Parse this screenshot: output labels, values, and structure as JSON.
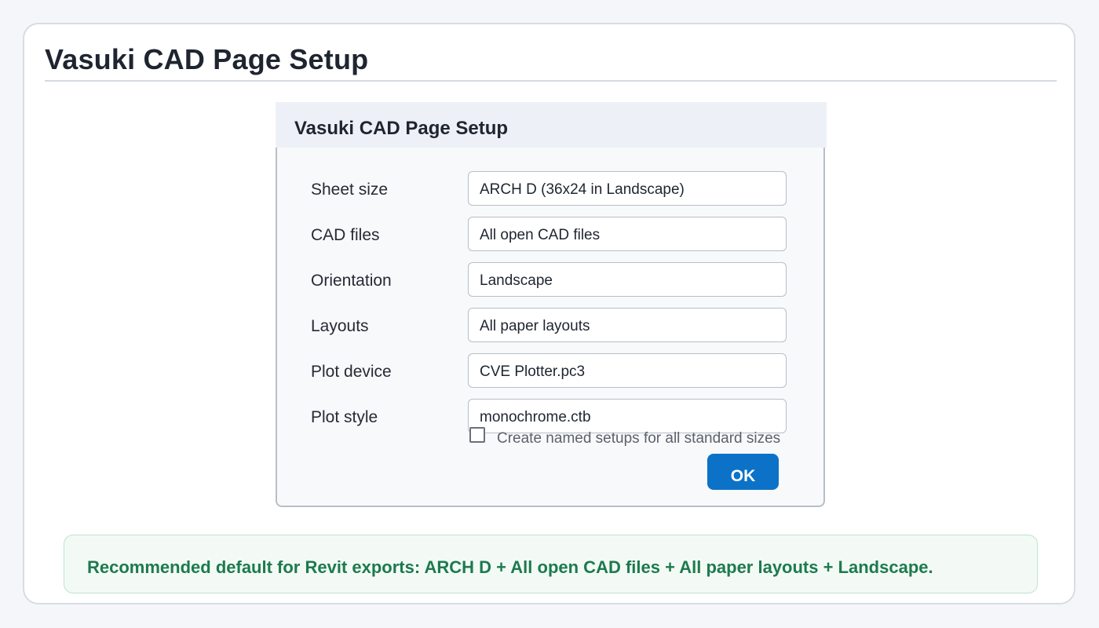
{
  "page": {
    "title": "Vasuki CAD Page Setup"
  },
  "dialog": {
    "title": "Vasuki CAD Page Setup",
    "fields": [
      {
        "label": "Sheet size",
        "value": "ARCH D (36x24 in Landscape)"
      },
      {
        "label": "CAD files",
        "value": "All open CAD files"
      },
      {
        "label": "Orientation",
        "value": "Landscape"
      },
      {
        "label": "Layouts",
        "value": "All paper layouts"
      },
      {
        "label": "Plot device",
        "value": "CVE Plotter.pc3"
      },
      {
        "label": "Plot style",
        "value": "monochrome.ctb"
      }
    ],
    "checkbox": {
      "label": "Create named setups for all standard sizes",
      "checked": false
    },
    "ok_label": "OK"
  },
  "note": {
    "text": "Recommended default for Revit exports: ARCH D + All open CAD files + All paper layouts + Landscape."
  },
  "colors": {
    "accent": "#0b72c7",
    "note_text": "#1d7a4d",
    "note_bg": "#f3faf6"
  }
}
